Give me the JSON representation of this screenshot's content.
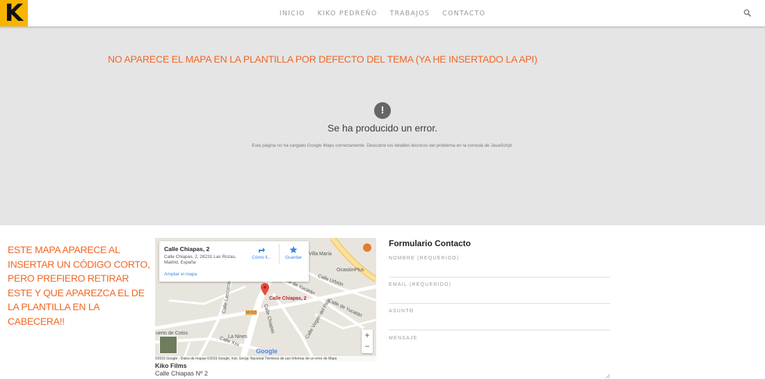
{
  "header": {
    "logo_letter": "K",
    "nav": [
      "INICIO",
      "KIKO PEDREÑO",
      "TRABAJOS",
      "CONTACTO"
    ],
    "search_icon": "search-icon"
  },
  "hero_map": {
    "annotation": "NO APARECE EL MAPA EN LA PLANTILLA POR DEFECTO DEL TEMA (YA HE INSERTADO LA API)",
    "error_icon": "!",
    "error_title": "Se ha producido un error.",
    "error_description": "Esta página no ha cargado Google Maps correctamente. Descubre los detalles técnicos del problema en la consola de JavaScript."
  },
  "side_note": "ESTE MAPA APARECE AL INSERTAR UN CÓDIGO CORTO, PERO PREFIERO RETIRAR ESTE Y QUE APAREZCA EL DE LA PLANTILLA EN LA CABECERA!!",
  "embedded_map": {
    "place_name": "Calle Chiapas, 2",
    "place_address": "Calle Chiapas, 2, 28231 Las Rozas, Madrid, España",
    "larger_map_link": "Ampliar el mapa",
    "directions_label": "Cómo ll...",
    "save_label": "Guardar",
    "marker_label": "Calle Chiapas, 2",
    "street_labels": [
      "Villa María",
      "OcasiónPlus",
      "Calle Urbión",
      "Calle de Yucatán",
      "Calle de Yucatán",
      "Calle Virgen del Pilar",
      "Calle Chiapas",
      "Calle Lanzarote",
      "M-515",
      "uerto de Cotos",
      "La Nines",
      "Calle Xxx"
    ],
    "google_logo": "Google",
    "footer": "©2016 Google - Datos de mapas ©2016 Google, Inst. Geogr. Nacional    Términos de uso    Informar de un error de Maps",
    "zoom_in": "+",
    "zoom_out": "−"
  },
  "company": {
    "name": "Kiko Films",
    "street": "Calle Chiapas Nº 2"
  },
  "form": {
    "title": "Formulario Contacto",
    "fields": [
      "NOMBRE (REQUERIDO)",
      "EMAIL (REQUERIDO)",
      "ASUNTO",
      "MENSAJE"
    ]
  },
  "colors": {
    "accent": "#f7b500",
    "annotation": "#f26522",
    "map_error_bg": "#e5e5e5"
  }
}
